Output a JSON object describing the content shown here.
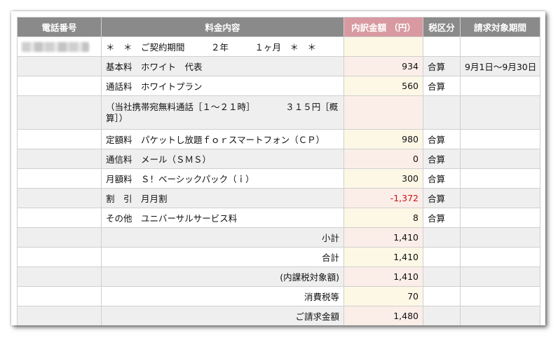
{
  "headers": [
    "電話番号",
    "料金内容",
    "内訳金額 （円）",
    "税区分",
    "請求対象期間"
  ],
  "rows": [
    {
      "phone_masked": true,
      "desc": "＊　＊　ご契約期間　　　２年　　　１ヶ月　＊　＊",
      "amount": "",
      "tax": "",
      "period": ""
    },
    {
      "desc": "基本料　ホワイト　代表",
      "amount": "934",
      "tax": "合算",
      "period": "9月1日〜9月30日"
    },
    {
      "desc": "通話料　ホワイトプラン",
      "amount": "560",
      "tax": "合算",
      "period": ""
    },
    {
      "desc": "（当社携帯宛無料通話［１〜２１時］　　　　３１５円［概算］）",
      "amount": "",
      "tax": "",
      "period": ""
    },
    {
      "desc": "定額料　パケットし放題ｆｏｒスマートフォン（ＣＰ）",
      "amount": "980",
      "tax": "合算",
      "period": ""
    },
    {
      "desc": "通信料　メール（ＳＭＳ）",
      "amount": "0",
      "tax": "合算",
      "period": ""
    },
    {
      "desc": "月額料　Ｓ！ベーシックパック（ｉ）",
      "amount": "300",
      "tax": "合算",
      "period": ""
    },
    {
      "desc": "割　引　月月割",
      "amount": "-1,372",
      "tax": "合算",
      "period": ""
    },
    {
      "desc": "その他　ユニバーサルサービス料",
      "amount": "8",
      "tax": "合算",
      "period": ""
    }
  ],
  "summary": [
    {
      "label": "小計",
      "amount": "1,410"
    },
    {
      "label": "合計",
      "amount": "1,410"
    },
    {
      "label": "(内課税対象額)",
      "amount": "1,410"
    },
    {
      "label": "消費税等",
      "amount": "70"
    },
    {
      "label": "ご請求金額",
      "amount": "1,480"
    }
  ],
  "colors": {
    "header_bg": "#8a8a8a",
    "amount_header_bg": "#d89aa0",
    "negative": "#cc1111"
  }
}
